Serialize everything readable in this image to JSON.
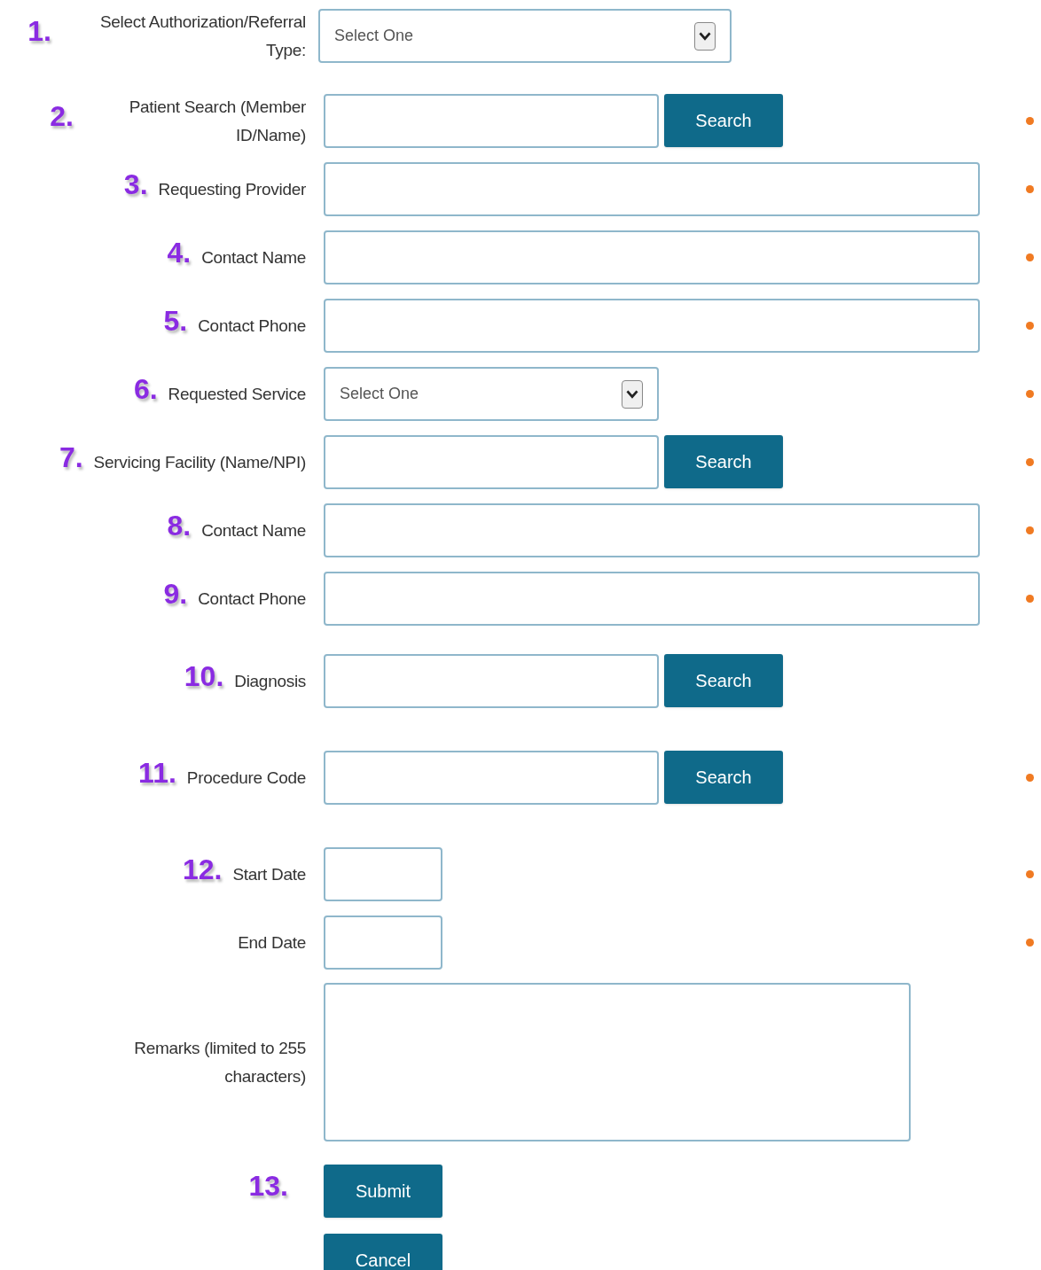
{
  "fields": [
    {
      "kind": "select",
      "number": "1.",
      "label": "Select Authorization/Referral Type:",
      "value": "Select One",
      "required": false
    },
    {
      "kind": "search",
      "number": "2.",
      "label": "Patient Search (Member ID/Name)",
      "button": "Search",
      "required": true
    },
    {
      "kind": "text",
      "number": "3.",
      "label": "Requesting Provider",
      "required": true
    },
    {
      "kind": "text",
      "number": "4.",
      "label": "Contact Name",
      "required": true
    },
    {
      "kind": "text",
      "number": "5.",
      "label": "Contact Phone",
      "required": true
    },
    {
      "kind": "select",
      "number": "6.",
      "label": "Requested Service",
      "value": "Select One",
      "required": true
    },
    {
      "kind": "search",
      "number": "7.",
      "label": "Servicing Facility (Name/NPI)",
      "button": "Search",
      "required": true
    },
    {
      "kind": "text",
      "number": "8.",
      "label": "Contact Name",
      "required": true
    },
    {
      "kind": "text",
      "number": "9.",
      "label": "Contact Phone",
      "required": true
    },
    {
      "kind": "search",
      "number": "10.",
      "label": "Diagnosis",
      "button": "Search",
      "required": false
    },
    {
      "kind": "search",
      "number": "11.",
      "label": "Procedure Code",
      "button": "Search",
      "required": true
    },
    {
      "kind": "date",
      "number": "12.",
      "label": "Start Date",
      "required": true
    },
    {
      "kind": "date",
      "label": "End Date",
      "required": true
    },
    {
      "kind": "textarea",
      "label": "Remarks (limited to 255 characters)",
      "required": false
    }
  ],
  "actions": {
    "number": "13.",
    "buttons": [
      "Submit",
      "Cancel"
    ]
  }
}
